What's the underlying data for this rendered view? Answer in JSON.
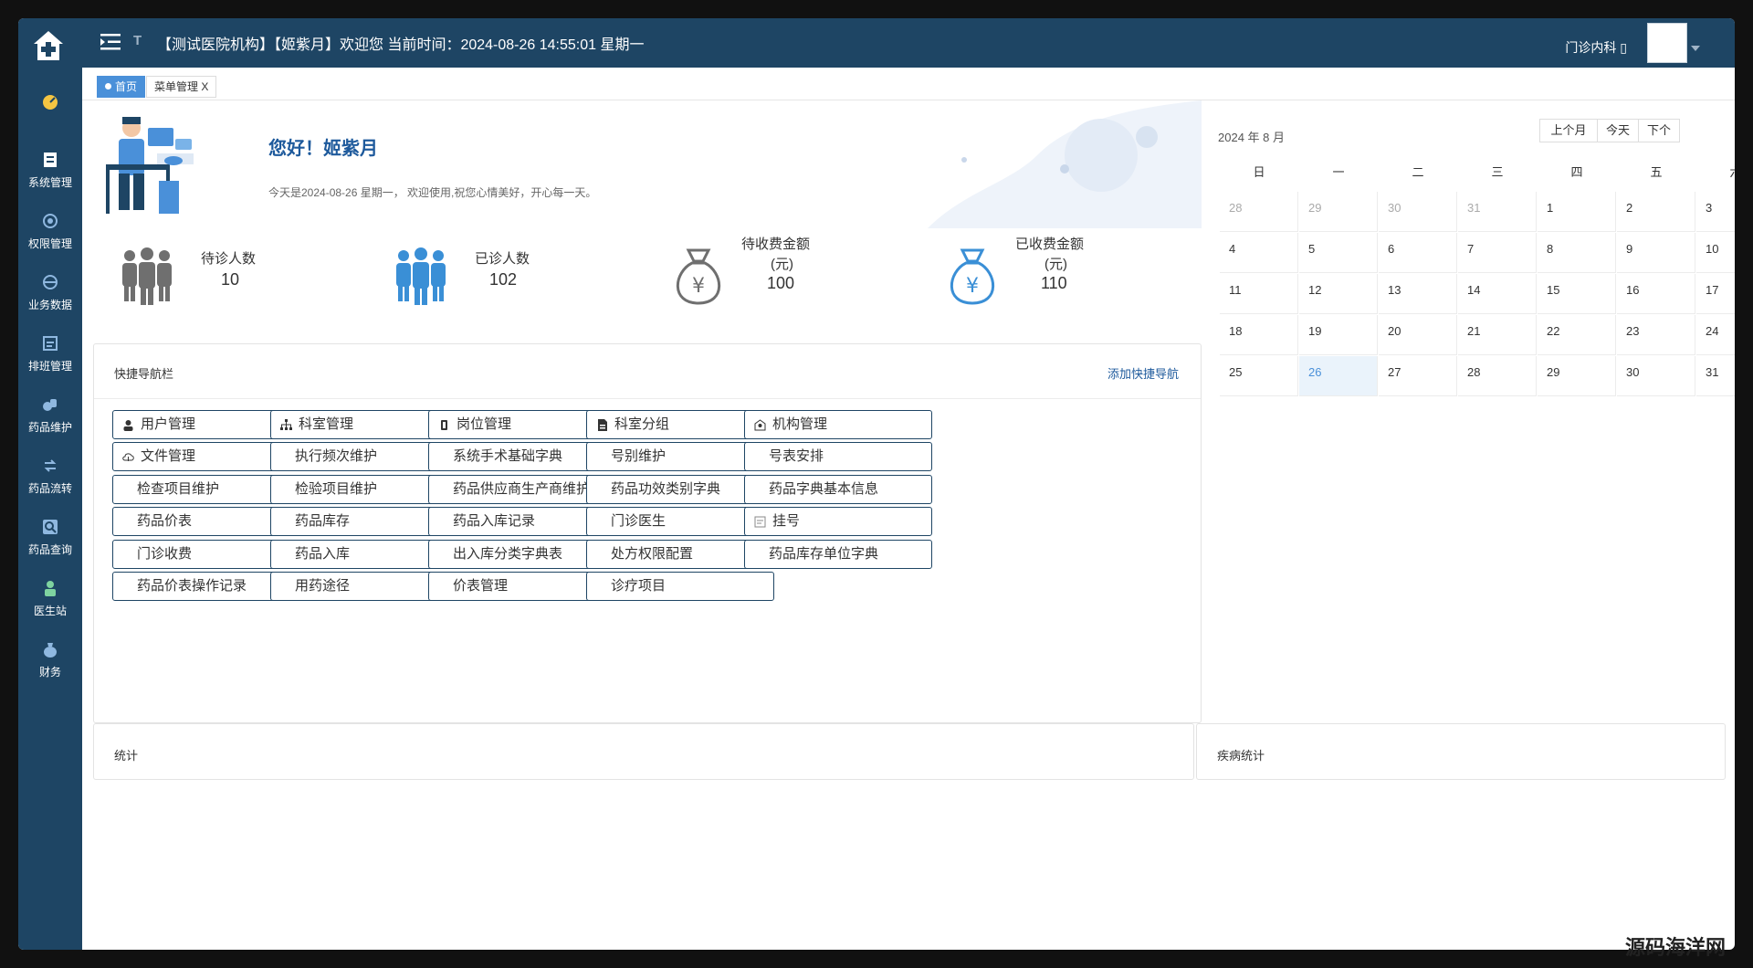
{
  "topbar": {
    "title": "【测试医院机构】【姬紫月】欢迎您  当前时间：2024-08-26 14:55:01 星期一",
    "font_icon": "T",
    "dept": "门诊内科 ▯"
  },
  "sidebar": {
    "items": [
      {
        "label": "",
        "icon": "dashboard-icon"
      },
      {
        "label": "系统管理",
        "icon": "system-icon"
      },
      {
        "label": "权限管理",
        "icon": "permission-icon"
      },
      {
        "label": "业务数据",
        "icon": "business-data-icon"
      },
      {
        "label": "排班管理",
        "icon": "schedule-icon"
      },
      {
        "label": "药品维护",
        "icon": "drug-maintain-icon"
      },
      {
        "label": "药品流转",
        "icon": "drug-flow-icon"
      },
      {
        "label": "药品查询",
        "icon": "drug-query-icon"
      },
      {
        "label": "医生站",
        "icon": "doctor-icon"
      },
      {
        "label": "财务",
        "icon": "finance-icon"
      }
    ]
  },
  "tabs": [
    {
      "label": "首页"
    },
    {
      "label": "菜单管理 X"
    }
  ],
  "welcome": {
    "greeting": "您好！姬紫月",
    "subtitle": "今天是2024-08-26   星期一， 欢迎使用,祝您心情美好，开心每一天。"
  },
  "stats": [
    {
      "label": "待诊人数",
      "value": "10"
    },
    {
      "label": "已诊人数",
      "value": "102"
    },
    {
      "label": "待收费金额",
      "label2": "(元)",
      "value": "100"
    },
    {
      "label": "已收费金额",
      "label2": "(元)",
      "value": "110"
    }
  ],
  "quick_nav": {
    "title": "快捷导航栏",
    "add_label": "添加快捷导航",
    "buttons": [
      {
        "label": "用户管理",
        "icon": "user-icon"
      },
      {
        "label": "科室管理",
        "icon": "org-tree-icon"
      },
      {
        "label": "岗位管理",
        "icon": "post-icon"
      },
      {
        "label": "科室分组",
        "icon": "file-icon"
      },
      {
        "label": "机构管理",
        "icon": "institution-icon"
      },
      {
        "label": "文件管理",
        "icon": "cloud-icon"
      },
      {
        "label": "执行频次维护",
        "icon": ""
      },
      {
        "label": "系统手术基础字典",
        "icon": ""
      },
      {
        "label": "号别维护",
        "icon": ""
      },
      {
        "label": "号表安排",
        "icon": ""
      },
      {
        "label": "检查项目维护",
        "icon": ""
      },
      {
        "label": "检验项目维护",
        "icon": ""
      },
      {
        "label": "药品供应商生产商维护",
        "icon": ""
      },
      {
        "label": "药品功效类别字典",
        "icon": ""
      },
      {
        "label": "药品字典基本信息",
        "icon": ""
      },
      {
        "label": "药品价表",
        "icon": ""
      },
      {
        "label": "药品库存",
        "icon": ""
      },
      {
        "label": "药品入库记录",
        "icon": ""
      },
      {
        "label": "门诊医生",
        "icon": ""
      },
      {
        "label": "挂号",
        "icon": "register-icon"
      },
      {
        "label": "门诊收费",
        "icon": ""
      },
      {
        "label": "药品入库",
        "icon": ""
      },
      {
        "label": "出入库分类字典表",
        "icon": ""
      },
      {
        "label": "处方权限配置",
        "icon": ""
      },
      {
        "label": "药品库存单位字典",
        "icon": ""
      },
      {
        "label": "药品价表操作记录",
        "icon": ""
      },
      {
        "label": "用药途径",
        "icon": ""
      },
      {
        "label": "价表管理",
        "icon": ""
      },
      {
        "label": "诊疗项目",
        "icon": ""
      }
    ]
  },
  "calendar": {
    "month_label": "2024 年 8 月",
    "prev_label": "上个月",
    "today_label": "今天",
    "next_label": "下个",
    "weekdays": [
      "日",
      "一",
      "二",
      "三",
      "四",
      "五",
      "六"
    ],
    "weeks": [
      [
        "28",
        "29",
        "30",
        "31",
        "1",
        "2",
        "3"
      ],
      [
        "4",
        "5",
        "6",
        "7",
        "8",
        "9",
        "10"
      ],
      [
        "11",
        "12",
        "13",
        "14",
        "15",
        "16",
        "17"
      ],
      [
        "18",
        "19",
        "20",
        "21",
        "22",
        "23",
        "24"
      ],
      [
        "25",
        "26",
        "27",
        "28",
        "29",
        "30",
        "31"
      ]
    ],
    "today": "26"
  },
  "panels": {
    "stats_title": "统计",
    "disease_title": "疾病统计"
  },
  "watermark": "源码海洋网",
  "colors": {
    "sidebar": "#1e4564",
    "accent": "#4a90d9",
    "stat_gray": "#6f6f6f",
    "stat_blue": "#3a8fd6"
  }
}
